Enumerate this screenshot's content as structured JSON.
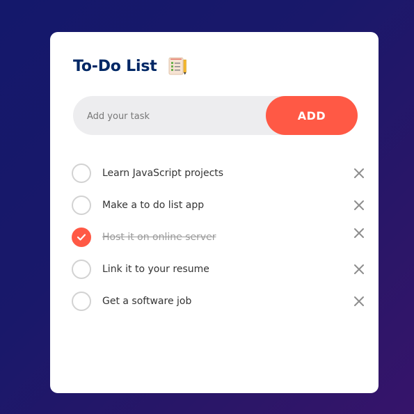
{
  "app": {
    "title": "To-Do List",
    "title_icon": "notepad-checklist-icon"
  },
  "input": {
    "placeholder": "Add your task",
    "value": "",
    "add_label": "ADD"
  },
  "tasks": [
    {
      "text": "Learn JavaScript projects",
      "done": false
    },
    {
      "text": "Make a to do list app",
      "done": false
    },
    {
      "text": "Host it on online server",
      "done": true
    },
    {
      "text": "Link it to your resume",
      "done": false
    },
    {
      "text": "Get a software job",
      "done": false
    }
  ],
  "colors": {
    "accent": "#ff5945",
    "title": "#002765",
    "background_start": "#14186b",
    "background_end": "#36146a",
    "input_bg": "#ededef"
  },
  "icons": {
    "delete": "close-icon",
    "check": "checkmark-icon"
  }
}
